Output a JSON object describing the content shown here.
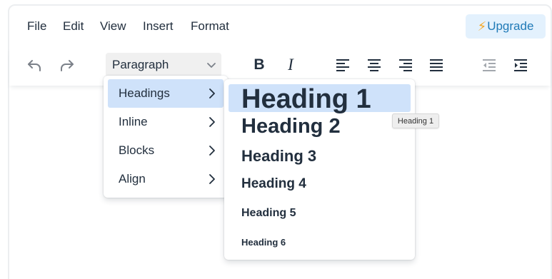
{
  "menubar": {
    "items": [
      "File",
      "Edit",
      "View",
      "Insert",
      "Format"
    ],
    "upgrade_icon": "⚡",
    "upgrade_label": "Upgrade"
  },
  "toolbar": {
    "blocks_value": "Paragraph",
    "bold_label": "B",
    "italic_label": "I",
    "icons": [
      "undo-icon",
      "redo-icon",
      "chevron-down-icon",
      "align-left-icon",
      "align-center-icon",
      "align-right-icon",
      "align-justify-icon",
      "outdent-icon",
      "indent-icon"
    ]
  },
  "format_menu": {
    "items": [
      "Headings",
      "Inline",
      "Blocks",
      "Align"
    ],
    "active": "Headings"
  },
  "headings_menu": {
    "items": [
      "Heading 1",
      "Heading 2",
      "Heading 3",
      "Heading 4",
      "Heading 5",
      "Heading 6"
    ],
    "active": "Heading 1"
  },
  "tooltip": {
    "text": "Heading 1"
  },
  "colors": {
    "text": "#222f3e",
    "highlight": "#cfe2fa",
    "upgrade_bg": "#e3f1fd",
    "upgrade_text": "#207ab7",
    "icon_disabled": "#7b8189"
  }
}
